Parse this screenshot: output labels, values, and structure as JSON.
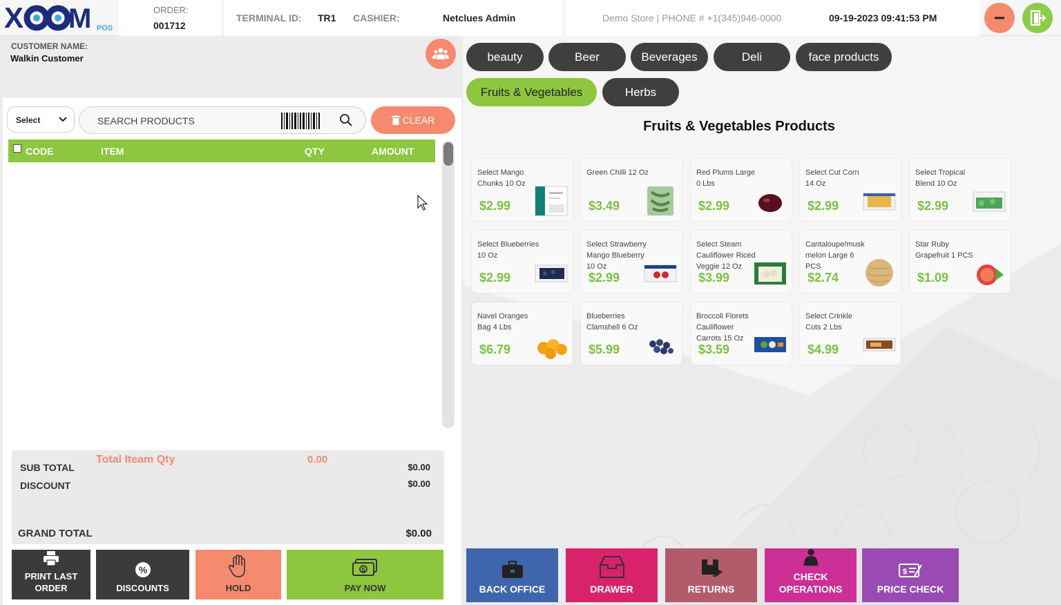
{
  "header": {
    "logo_text": "XOOM",
    "logo_sub": "POS",
    "order_label": "ORDER:",
    "order_value": "001712",
    "terminal_label": "TERMINAL ID:",
    "terminal_value": "TR1",
    "cashier_label": "CASHIER:",
    "cashier_value": "Netclues Admin",
    "store_info": "Demo Store | PHONE # +1(345)946-0000",
    "datetime": "09-19-2023 09:41:53 PM"
  },
  "customer": {
    "label": "CUSTOMER NAME:",
    "value": "Walkin Customer"
  },
  "cart": {
    "select_value": "Select",
    "search_placeholder": "SEARCH PRODUCTS",
    "clear_label": "CLEAR",
    "columns": [
      "CODE",
      "ITEM",
      "QTY",
      "AMOUNT"
    ]
  },
  "totals": {
    "total_item_qty_label": "Total Iteam Qty",
    "total_item_qty_value": "0.00",
    "subtotal_label": "SUB TOTAL",
    "subtotal_value": "$0.00",
    "discount_label": "DISCOUNT",
    "discount_value": "$0.00",
    "grand_total_label": "GRAND TOTAL",
    "grand_total_value": "$0.00"
  },
  "bottom_buttons": {
    "print_last_order": "PRINT LAST ORDER",
    "discounts": "DISCOUNTS",
    "hold": "HOLD",
    "pay_now": "PAY NOW"
  },
  "categories": [
    "beauty",
    "Beer",
    "Beverages",
    "Deli",
    "face products",
    "Fruits & Vegetables",
    "Herbs"
  ],
  "active_category": "Fruits & Vegetables",
  "products_title": "Fruits & Vegetables Products",
  "products": [
    {
      "name": "Select Mango Chunks 10 Oz",
      "price": "$2.99"
    },
    {
      "name": "Green Chilli 12 Oz",
      "price": "$3.49"
    },
    {
      "name": "Red Plums Large 0 Lbs",
      "price": "$2.99"
    },
    {
      "name": "Select Cut Corn 14 Oz",
      "price": "$2.99"
    },
    {
      "name": "Select Tropical Blend 10 Oz",
      "price": "$2.99"
    },
    {
      "name": "Select Blueberries 10 Oz",
      "price": "$2.99"
    },
    {
      "name": "Select Strawberry Mango Blueberry 10 Oz",
      "price": "$2.99"
    },
    {
      "name": "Select Steam Cauliflower Riced Veggie 12 Oz",
      "price": "$3.99"
    },
    {
      "name": "Cantaloupe/musk melon Large 6 PCS",
      "price": "$2.74"
    },
    {
      "name": "Star Ruby Grapefruit 1 PCS",
      "price": "$1.09"
    },
    {
      "name": "Navel Oranges Bag 4 Lbs",
      "price": "$6.79"
    },
    {
      "name": "Blueberries Clamshell 6 Oz",
      "price": "$5.99"
    },
    {
      "name": "Broccoli Florets Cauliflower Carrots 15 Oz",
      "price": "$3.59"
    },
    {
      "name": "Select Crinkle Cuts 2 Lbs",
      "price": "$4.99"
    }
  ],
  "actions": {
    "back_office": "BACK OFFICE",
    "drawer": "DRAWER",
    "returns": "RETURNS",
    "check_operations": "CHECK OPERATIONS",
    "price_check": "PRICE CHECK"
  },
  "colors": {
    "accent_green": "#8dc63f",
    "accent_orange": "#f58a6e",
    "dark_button": "#3f3f3f",
    "back_office": "#3f66ad",
    "drawer": "#d8236b",
    "returns": "#b25c6b",
    "check_operations": "#cc2f95",
    "price_check": "#9a4bb3"
  }
}
